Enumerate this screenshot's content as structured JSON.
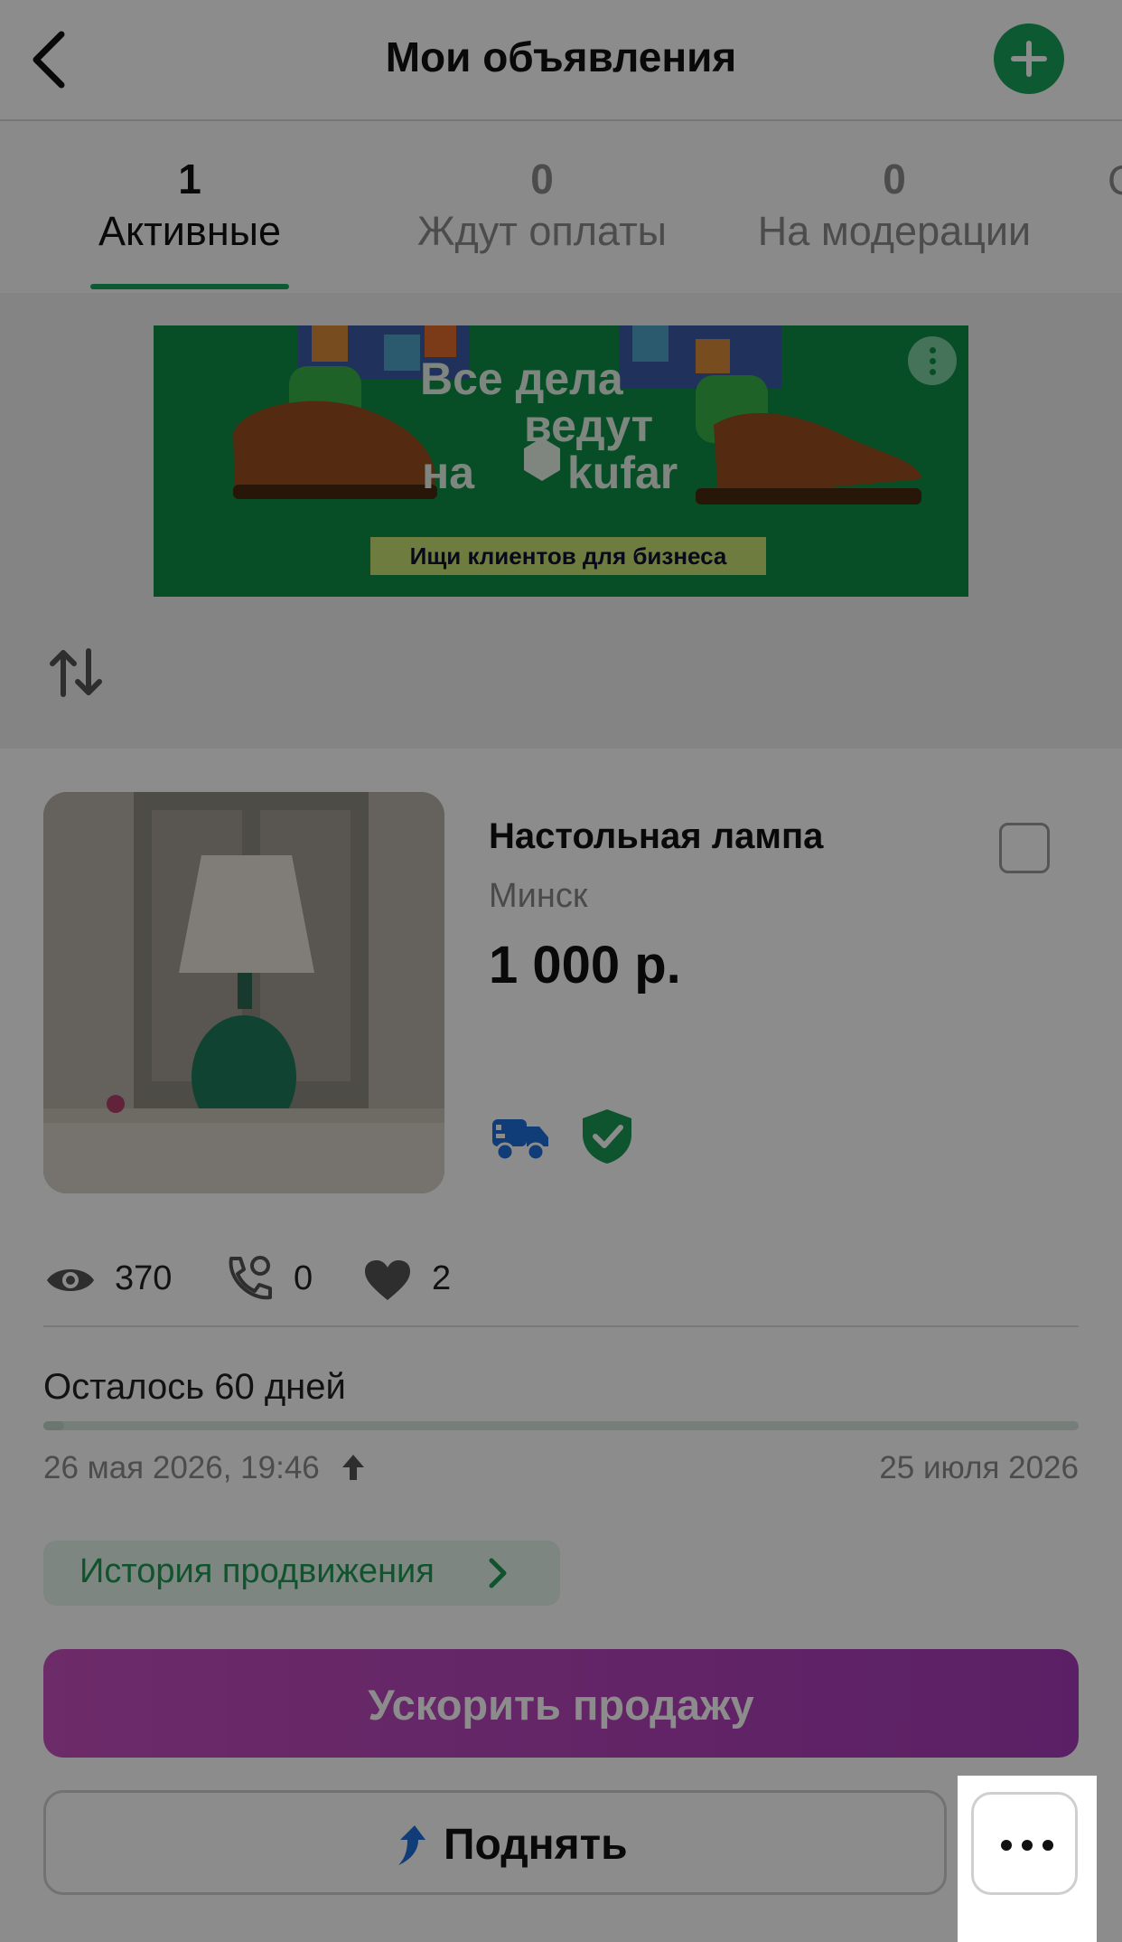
{
  "header": {
    "title": "Мои объявления",
    "back_icon": "chevron-left-icon",
    "add_icon": "plus-icon",
    "accent": "#18a35a"
  },
  "tabs": [
    {
      "count": "1",
      "label": "Активные",
      "active": true
    },
    {
      "count": "0",
      "label": "Ждут оплаты",
      "active": false
    },
    {
      "count": "0",
      "label": "На модерации",
      "active": false
    },
    {
      "count": "",
      "label": "С",
      "active": false
    }
  ],
  "banner": {
    "line1": "Все дела",
    "line2": "ведут",
    "line3": "на",
    "brand": "kufar",
    "subtitle": "Ищи клиентов для бизнеса",
    "bg": "#0e8e48"
  },
  "sort": {
    "icon": "sort-arrows-icon"
  },
  "listing": {
    "title": "Настольная лампа",
    "city": "Минск",
    "price": "1 000 р.",
    "badges": [
      "delivery-truck-icon",
      "shield-check-icon"
    ],
    "stats": {
      "views": "370",
      "calls": "0",
      "favorites": "2"
    },
    "days_left": "Осталось 60 дней",
    "progress_fraction": 0.02,
    "date_start": "26 мая 2026, 19:46",
    "date_end": "25 июля 2026",
    "history_label": "История продвижения",
    "boost_label": "Ускорить продажу",
    "raise_label": "Поднять"
  }
}
